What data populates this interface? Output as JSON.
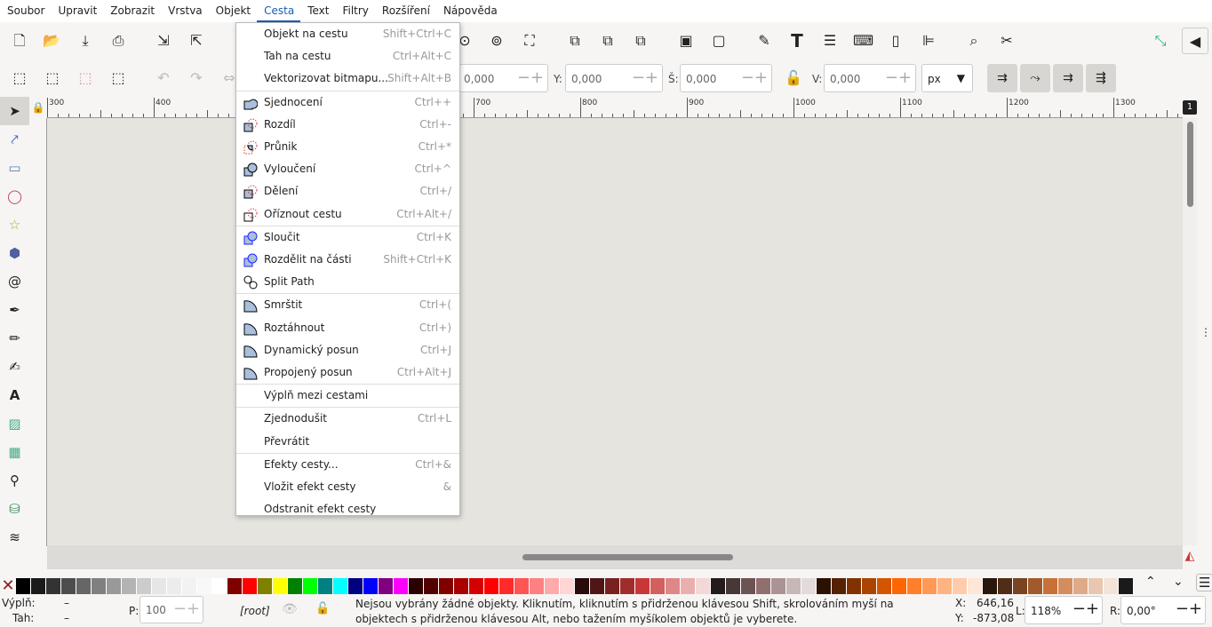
{
  "menubar": [
    "Soubor",
    "Upravit",
    "Zobrazit",
    "Vrstva",
    "Objekt",
    "Cesta",
    "Text",
    "Filtry",
    "Rozšíření",
    "Nápověda"
  ],
  "active_menu": "Cesta",
  "toolbar2": {
    "x_value": "0,000",
    "y_label": "Y:",
    "y_value": "0,000",
    "w_label": "Š:",
    "w_value": "0,000",
    "h_label": "V:",
    "h_value": "0,000",
    "unit": "px"
  },
  "ruler": [
    "300",
    "400",
    "500",
    "600",
    "700",
    "800",
    "900",
    "1000",
    "1100",
    "1200",
    "1300"
  ],
  "ruler_badge": "1",
  "menu": [
    {
      "label": "Objekt na cestu",
      "shortcut": "Shift+Ctrl+C",
      "icon": ""
    },
    {
      "label": "Tah na cestu",
      "shortcut": "Ctrl+Alt+C",
      "icon": ""
    },
    {
      "label": "Vektorizovat bitmapu...",
      "shortcut": "Shift+Alt+B",
      "icon": ""
    },
    {
      "label": "Sjednocení",
      "shortcut": "Ctrl++",
      "icon": "union-icon",
      "sep": true
    },
    {
      "label": "Rozdíl",
      "shortcut": "Ctrl+-",
      "icon": "difference-icon"
    },
    {
      "label": "Průnik",
      "shortcut": "Ctrl+*",
      "icon": "intersection-icon"
    },
    {
      "label": "Vyloučení",
      "shortcut": "Ctrl+^",
      "icon": "exclusion-icon"
    },
    {
      "label": "Dělení",
      "shortcut": "Ctrl+/",
      "icon": "division-icon"
    },
    {
      "label": "Oříznout cestu",
      "shortcut": "Ctrl+Alt+/",
      "icon": "cut-path-icon"
    },
    {
      "label": "Sloučit",
      "shortcut": "Ctrl+K",
      "icon": "combine-icon",
      "sep": true
    },
    {
      "label": "Rozdělit na části",
      "shortcut": "Shift+Ctrl+K",
      "icon": "break-apart-icon"
    },
    {
      "label": "Split Path",
      "shortcut": "",
      "icon": "split-path-icon"
    },
    {
      "label": "Smrštit",
      "shortcut": "Ctrl+(",
      "icon": "inset-icon",
      "sep": true
    },
    {
      "label": "Roztáhnout",
      "shortcut": "Ctrl+)",
      "icon": "outset-icon"
    },
    {
      "label": "Dynamický posun",
      "shortcut": "Ctrl+J",
      "icon": "dynamic-offset-icon"
    },
    {
      "label": "Propojený posun",
      "shortcut": "Ctrl+Alt+J",
      "icon": "linked-offset-icon"
    },
    {
      "label": "Výplň mezi cestami",
      "shortcut": "",
      "icon": "",
      "sep": true
    },
    {
      "label": "Zjednodušit",
      "shortcut": "Ctrl+L",
      "icon": "",
      "sep": true
    },
    {
      "label": "Převrátit",
      "shortcut": "",
      "icon": ""
    },
    {
      "label": "Efekty cesty...",
      "shortcut": "Ctrl+&",
      "icon": "",
      "sep": true
    },
    {
      "label": "Vložit efekt cesty",
      "shortcut": "&",
      "icon": ""
    },
    {
      "label": "Odstranit efekt cesty",
      "shortcut": "",
      "icon": ""
    }
  ],
  "palette": [
    "#000000",
    "#1a1a1a",
    "#333333",
    "#4d4d4d",
    "#666666",
    "#808080",
    "#999999",
    "#b3b3b3",
    "#cccccc",
    "#e6e6e6",
    "#ececec",
    "#f2f2f2",
    "#f8f8f8",
    "#ffffff",
    "#800000",
    "#ff0000",
    "#808000",
    "#ffff00",
    "#008000",
    "#00ff00",
    "#008080",
    "#00ffff",
    "#000080",
    "#0000ff",
    "#800080",
    "#ff00ff",
    "#2b0000",
    "#550000",
    "#800000",
    "#aa0000",
    "#d40000",
    "#ff0000",
    "#ff2a2a",
    "#ff5555",
    "#ff8080",
    "#ffaaaa",
    "#ffd5d5",
    "#280b0b",
    "#501616",
    "#782121",
    "#a02c2c",
    "#c83737",
    "#d35f5f",
    "#de8787",
    "#e9afaf",
    "#f4d7d7",
    "#241c1c",
    "#483737",
    "#6c5353",
    "#916f6f",
    "#ac9393",
    "#c8b7b7",
    "#e3dbdb",
    "#2b1100",
    "#552200",
    "#803300",
    "#aa4400",
    "#d45500",
    "#ff6600",
    "#ff7f2a",
    "#ff9955",
    "#ffb380",
    "#ffccaa",
    "#ffe6d5",
    "#28170b",
    "#502d16",
    "#784421",
    "#a05a2c",
    "#c87137",
    "#d38d5f",
    "#deaa87",
    "#e9c6af",
    "#f4e3d7",
    "#1a1a1a"
  ],
  "status": {
    "fill_label": "Výplň:",
    "fill_value": "–",
    "stroke_label": "Tah:",
    "stroke_value": "–",
    "opacity_label": "P:",
    "opacity_value": "100",
    "layer": "[root]",
    "message": "Nejsou vybrány žádné objekty. Kliknutím, kliknutím s přidrženou klávesou Shift, skrolováním myší na objektech s přidrženou klávesou Alt, nebo tažením myšíkolem objektů je vyberete.",
    "x_label": "X:",
    "x_value": "646,16",
    "y_label": "Y:",
    "y_value": "-873,08",
    "zoom_label": "L:",
    "zoom_value": "118%",
    "rotate_label": "R:",
    "rotate_value": "0,00°"
  }
}
